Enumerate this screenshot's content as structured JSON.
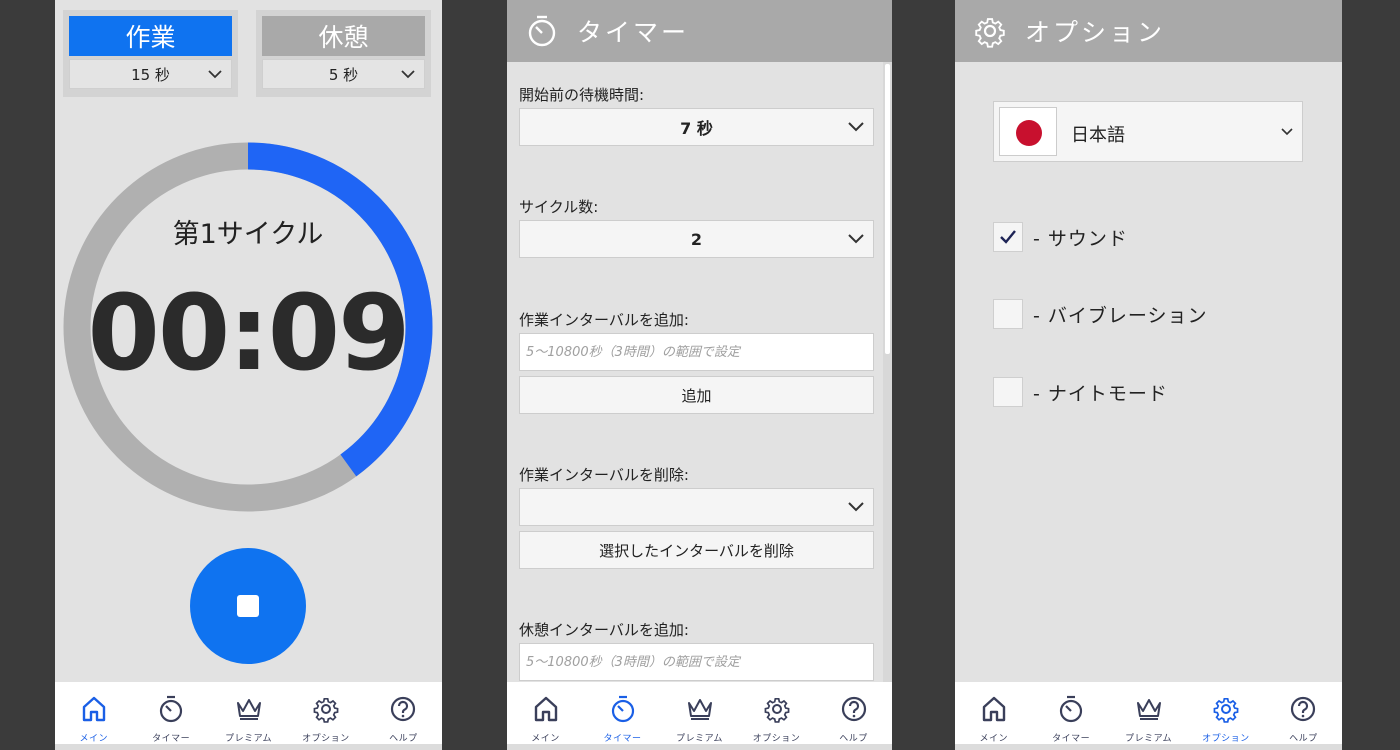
{
  "colors": {
    "accent": "#1a5fe6",
    "ring_progress": "#1f65f5",
    "ring_track": "#b0b0b0",
    "work_active": "#0f73f0",
    "rest_inactive": "#a9a9a9",
    "header": "#a9a9a9"
  },
  "nav": {
    "items": [
      {
        "key": "home",
        "label": "メイン",
        "icon": "home-icon"
      },
      {
        "key": "timer",
        "label": "タイマー",
        "icon": "stopwatch-icon"
      },
      {
        "key": "premium",
        "label": "プレミアム",
        "icon": "crown-icon"
      },
      {
        "key": "options",
        "label": "オプション",
        "icon": "gear-icon"
      },
      {
        "key": "help",
        "label": "ヘルプ",
        "icon": "help-icon"
      }
    ]
  },
  "main": {
    "work": {
      "title": "作業",
      "value": "15 秒",
      "active": true
    },
    "rest": {
      "title": "休憩",
      "value": "5 秒",
      "active": false
    },
    "cycle_label": "第1サイクル",
    "time": "00:09",
    "progress_fraction": 0.4,
    "stop_icon": "stop-icon"
  },
  "timer": {
    "header_title": "タイマー",
    "header_icon": "stopwatch-icon",
    "wait_label": "開始前の待機時間:",
    "wait_value": "7 秒",
    "cycles_label": "サイクル数:",
    "cycles_value": "2",
    "add_work_label": "作業インターバルを追加:",
    "add_work_placeholder": "5〜10800秒（3時間）の範囲で設定",
    "add_button": "追加",
    "remove_work_label": "作業インターバルを削除:",
    "remove_work_value": "",
    "remove_button": "選択したインターバルを削除",
    "add_rest_label": "休憩インターバルを追加:",
    "add_rest_placeholder": "5〜10800秒（3時間）の範囲で設定"
  },
  "options": {
    "header_title": "オプション",
    "header_icon": "gear-icon",
    "language": "日本語",
    "flag_icon": "japan-flag-icon",
    "sound_label": "- サウンド",
    "sound_checked": true,
    "vibration_label": "- バイブレーション",
    "vibration_checked": false,
    "night_label": "- ナイトモード",
    "night_checked": false
  }
}
